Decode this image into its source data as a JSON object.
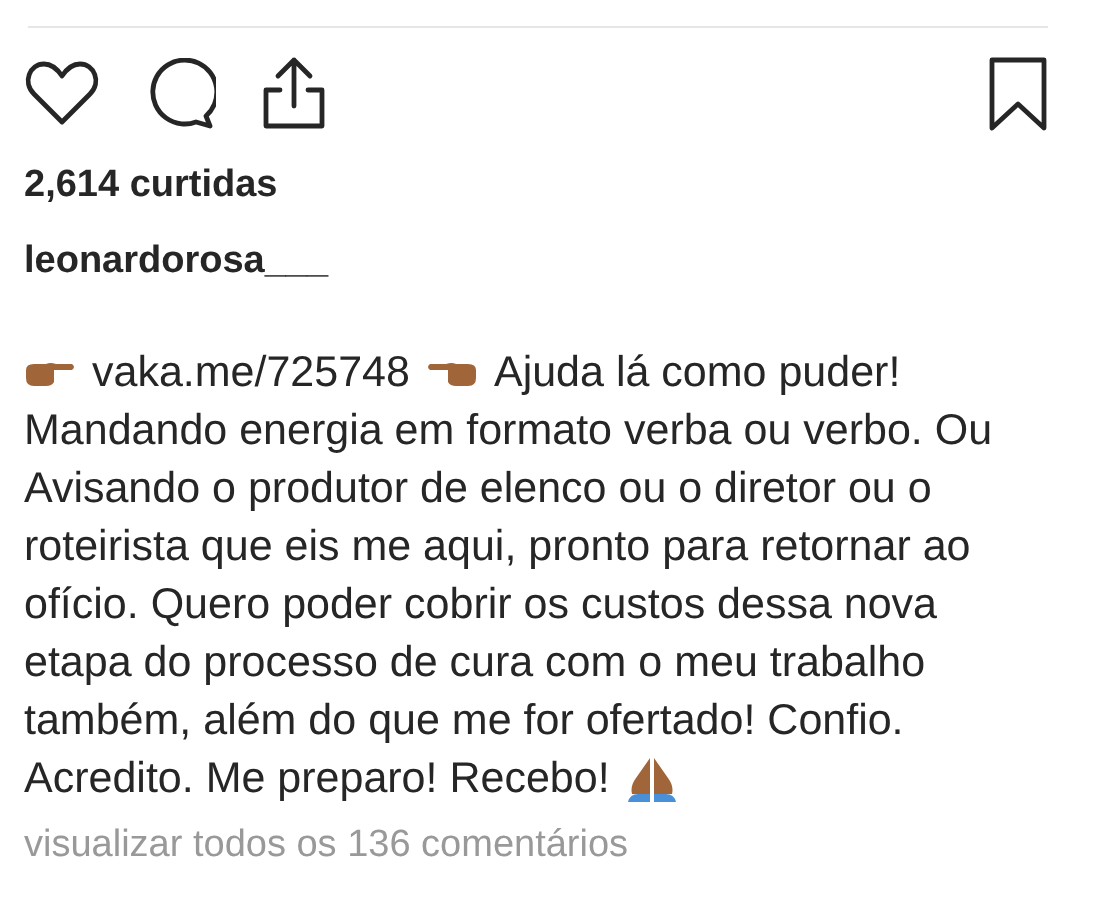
{
  "post": {
    "likes": "2,614 curtidas",
    "username": "leonardorosa___",
    "caption": {
      "link": "vaka.me/725748",
      "headline": "Ajuda lá como puder!",
      "body": "Mandando energia em formato verba ou verbo. Ou Avisando o produtor de elenco ou o diretor ou o roteirista que eis me aqui, pronto para retornar ao ofício. Quero poder cobrir os custos dessa nova etapa do processo de cura com o meu trabalho também, além do que me for ofertado! Confio.",
      "closing": "Acredito. Me preparo! Recebo!"
    },
    "comments_link": "visualizar todos os 136 comentários"
  }
}
